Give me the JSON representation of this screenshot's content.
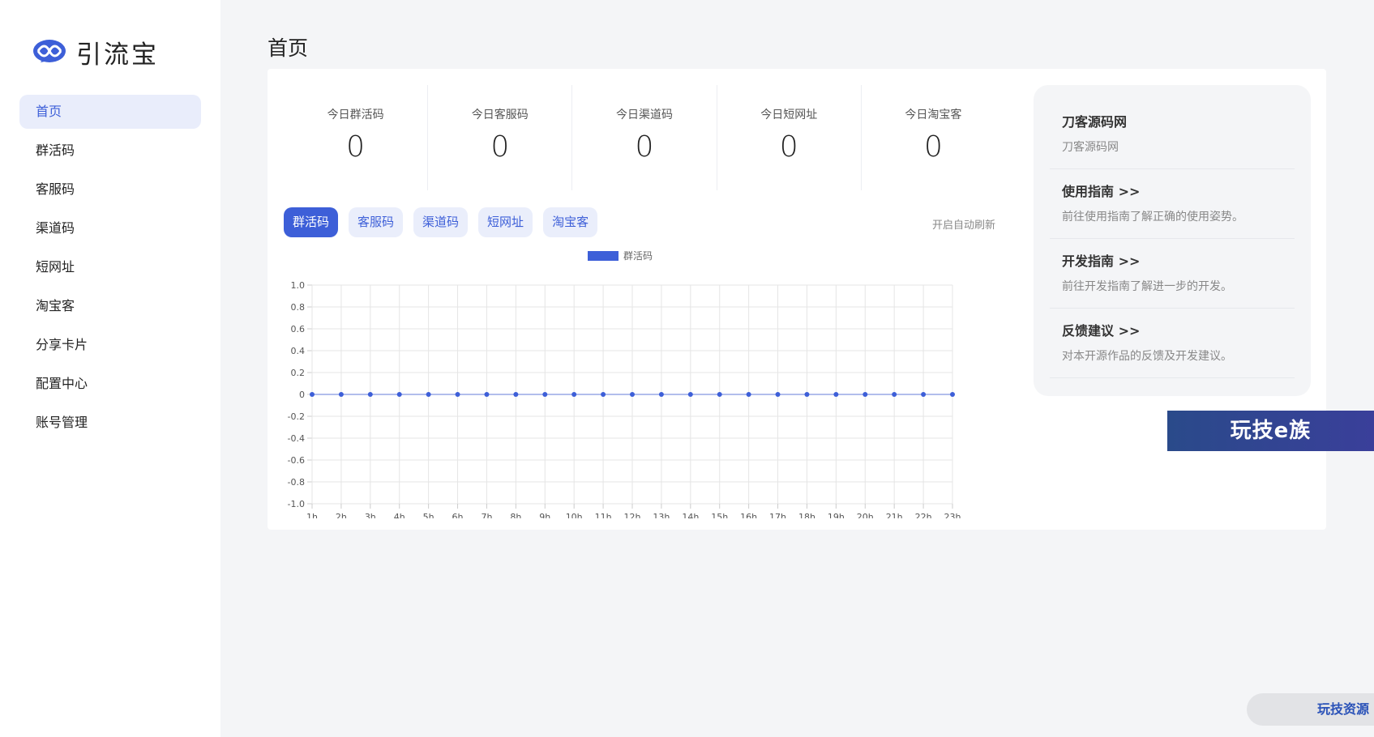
{
  "app": {
    "name": "引流宝"
  },
  "sidebar": {
    "items": [
      {
        "label": "首页",
        "active": true
      },
      {
        "label": "群活码"
      },
      {
        "label": "客服码"
      },
      {
        "label": "渠道码"
      },
      {
        "label": "短网址"
      },
      {
        "label": "淘宝客"
      },
      {
        "label": "分享卡片"
      },
      {
        "label": "配置中心"
      },
      {
        "label": "账号管理"
      }
    ]
  },
  "page": {
    "title": "首页"
  },
  "stats": [
    {
      "label": "今日群活码",
      "value": "0"
    },
    {
      "label": "今日客服码",
      "value": "0"
    },
    {
      "label": "今日渠道码",
      "value": "0"
    },
    {
      "label": "今日短网址",
      "value": "0"
    },
    {
      "label": "今日淘宝客",
      "value": "0"
    }
  ],
  "tabs": [
    {
      "label": "群活码",
      "active": true
    },
    {
      "label": "客服码"
    },
    {
      "label": "渠道码"
    },
    {
      "label": "短网址"
    },
    {
      "label": "淘宝客"
    }
  ],
  "auto_refresh_label": "开启自动刷新",
  "chart_data": {
    "type": "line",
    "x": [
      "1h",
      "2h",
      "3h",
      "4h",
      "5h",
      "6h",
      "7h",
      "8h",
      "9h",
      "10h",
      "11h",
      "12h",
      "13h",
      "14h",
      "15h",
      "16h",
      "17h",
      "18h",
      "19h",
      "20h",
      "21h",
      "22h",
      "23h"
    ],
    "series": [
      {
        "name": "群活码",
        "values": [
          0,
          0,
          0,
          0,
          0,
          0,
          0,
          0,
          0,
          0,
          0,
          0,
          0,
          0,
          0,
          0,
          0,
          0,
          0,
          0,
          0,
          0,
          0
        ],
        "color": "#3d5fd8"
      }
    ],
    "ylim": [
      -1.0,
      1.0
    ],
    "yticks": [
      "1.0",
      "0.8",
      "0.6",
      "0.4",
      "0.2",
      "0",
      "-0.2",
      "-0.4",
      "-0.6",
      "-0.8",
      "-1.0"
    ],
    "legend": "top-center",
    "grid": true
  },
  "side_panel": {
    "items": [
      {
        "title": "刀客源码网",
        "desc": "刀客源码网"
      },
      {
        "title": "使用指南 >>",
        "desc": "前往使用指南了解正确的使用姿势。"
      },
      {
        "title": "开发指南 >>",
        "desc": "前往开发指南了解进一步的开发。"
      },
      {
        "title": "反馈建议 >>",
        "desc": "对本开源作品的反馈及开发建议。"
      }
    ]
  },
  "banner": {
    "text": "玩技e族"
  },
  "floating_button": {
    "label": "玩技资源"
  },
  "colors": {
    "accent": "#3d5fd8",
    "accent_light": "#eaeefb",
    "background": "#f4f5f7"
  }
}
